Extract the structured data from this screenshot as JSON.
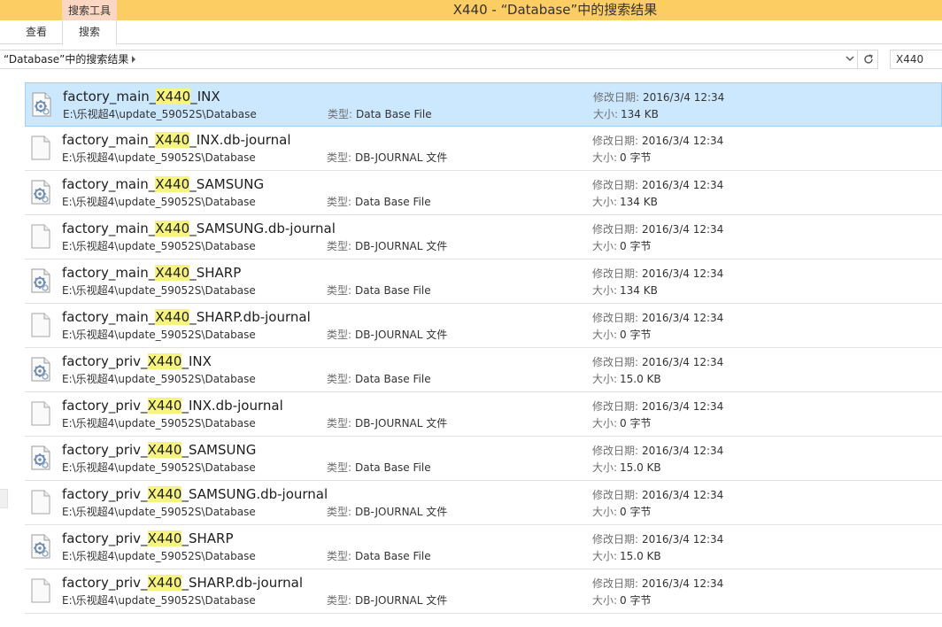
{
  "window": {
    "title": "X440 - “Database”中的搜索结果",
    "context_tab_group": "搜索工具"
  },
  "ribbon": {
    "tabs": [
      {
        "label": "查看"
      },
      {
        "label": "搜索"
      }
    ]
  },
  "address": {
    "breadcrumb": "“Database”中的搜索结果",
    "search_value": "X440"
  },
  "labels": {
    "type": "类型:",
    "modified": "修改日期:",
    "size": "大小:"
  },
  "search_term": "X440",
  "files": [
    {
      "name_pre": "factory_main_",
      "name_hl": "X440",
      "name_post": "_INX",
      "path": "E:\\乐视超4\\update_59052S\\Database",
      "type": "Data Base File",
      "modified": "2016/3/4 12:34",
      "size": "134 KB",
      "icon": "database-file-icon",
      "selected": true
    },
    {
      "name_pre": "factory_main_",
      "name_hl": "X440",
      "name_post": "_INX.db-journal",
      "path": "E:\\乐视超4\\update_59052S\\Database",
      "type": "DB-JOURNAL 文件",
      "modified": "2016/3/4 12:34",
      "size": "0 字节",
      "icon": "blank-file-icon",
      "selected": false
    },
    {
      "name_pre": "factory_main_",
      "name_hl": "X440",
      "name_post": "_SAMSUNG",
      "path": "E:\\乐视超4\\update_59052S\\Database",
      "type": "Data Base File",
      "modified": "2016/3/4 12:34",
      "size": "134 KB",
      "icon": "database-file-icon",
      "selected": false
    },
    {
      "name_pre": "factory_main_",
      "name_hl": "X440",
      "name_post": "_SAMSUNG.db-journal",
      "path": "E:\\乐视超4\\update_59052S\\Database",
      "type": "DB-JOURNAL 文件",
      "modified": "2016/3/4 12:34",
      "size": "0 字节",
      "icon": "blank-file-icon",
      "selected": false
    },
    {
      "name_pre": "factory_main_",
      "name_hl": "X440",
      "name_post": "_SHARP",
      "path": "E:\\乐视超4\\update_59052S\\Database",
      "type": "Data Base File",
      "modified": "2016/3/4 12:34",
      "size": "134 KB",
      "icon": "database-file-icon",
      "selected": false
    },
    {
      "name_pre": "factory_main_",
      "name_hl": "X440",
      "name_post": "_SHARP.db-journal",
      "path": "E:\\乐视超4\\update_59052S\\Database",
      "type": "DB-JOURNAL 文件",
      "modified": "2016/3/4 12:34",
      "size": "0 字节",
      "icon": "blank-file-icon",
      "selected": false
    },
    {
      "name_pre": "factory_priv_",
      "name_hl": "X440",
      "name_post": "_INX",
      "path": "E:\\乐视超4\\update_59052S\\Database",
      "type": "Data Base File",
      "modified": "2016/3/4 12:34",
      "size": "15.0 KB",
      "icon": "database-file-icon",
      "selected": false
    },
    {
      "name_pre": "factory_priv_",
      "name_hl": "X440",
      "name_post": "_INX.db-journal",
      "path": "E:\\乐视超4\\update_59052S\\Database",
      "type": "DB-JOURNAL 文件",
      "modified": "2016/3/4 12:34",
      "size": "0 字节",
      "icon": "blank-file-icon",
      "selected": false
    },
    {
      "name_pre": "factory_priv_",
      "name_hl": "X440",
      "name_post": "_SAMSUNG",
      "path": "E:\\乐视超4\\update_59052S\\Database",
      "type": "Data Base File",
      "modified": "2016/3/4 12:34",
      "size": "15.0 KB",
      "icon": "database-file-icon",
      "selected": false
    },
    {
      "name_pre": "factory_priv_",
      "name_hl": "X440",
      "name_post": "_SAMSUNG.db-journal",
      "path": "E:\\乐视超4\\update_59052S\\Database",
      "type": "DB-JOURNAL 文件",
      "modified": "2016/3/4 12:34",
      "size": "0 字节",
      "icon": "blank-file-icon",
      "selected": false
    },
    {
      "name_pre": "factory_priv_",
      "name_hl": "X440",
      "name_post": "_SHARP",
      "path": "E:\\乐视超4\\update_59052S\\Database",
      "type": "Data Base File",
      "modified": "2016/3/4 12:34",
      "size": "15.0 KB",
      "icon": "database-file-icon",
      "selected": false
    },
    {
      "name_pre": "factory_priv_",
      "name_hl": "X440",
      "name_post": "_SHARP.db-journal",
      "path": "E:\\乐视超4\\update_59052S\\Database",
      "type": "DB-JOURNAL 文件",
      "modified": "2016/3/4 12:34",
      "size": "0 字节",
      "icon": "blank-file-icon",
      "selected": false
    }
  ],
  "colors": {
    "titlebar": "#fbcd62",
    "context_tab": "#fbd7c3",
    "selection": "#cce8ff",
    "selection_border": "#99d1ff",
    "highlight": "#f6f47f"
  }
}
